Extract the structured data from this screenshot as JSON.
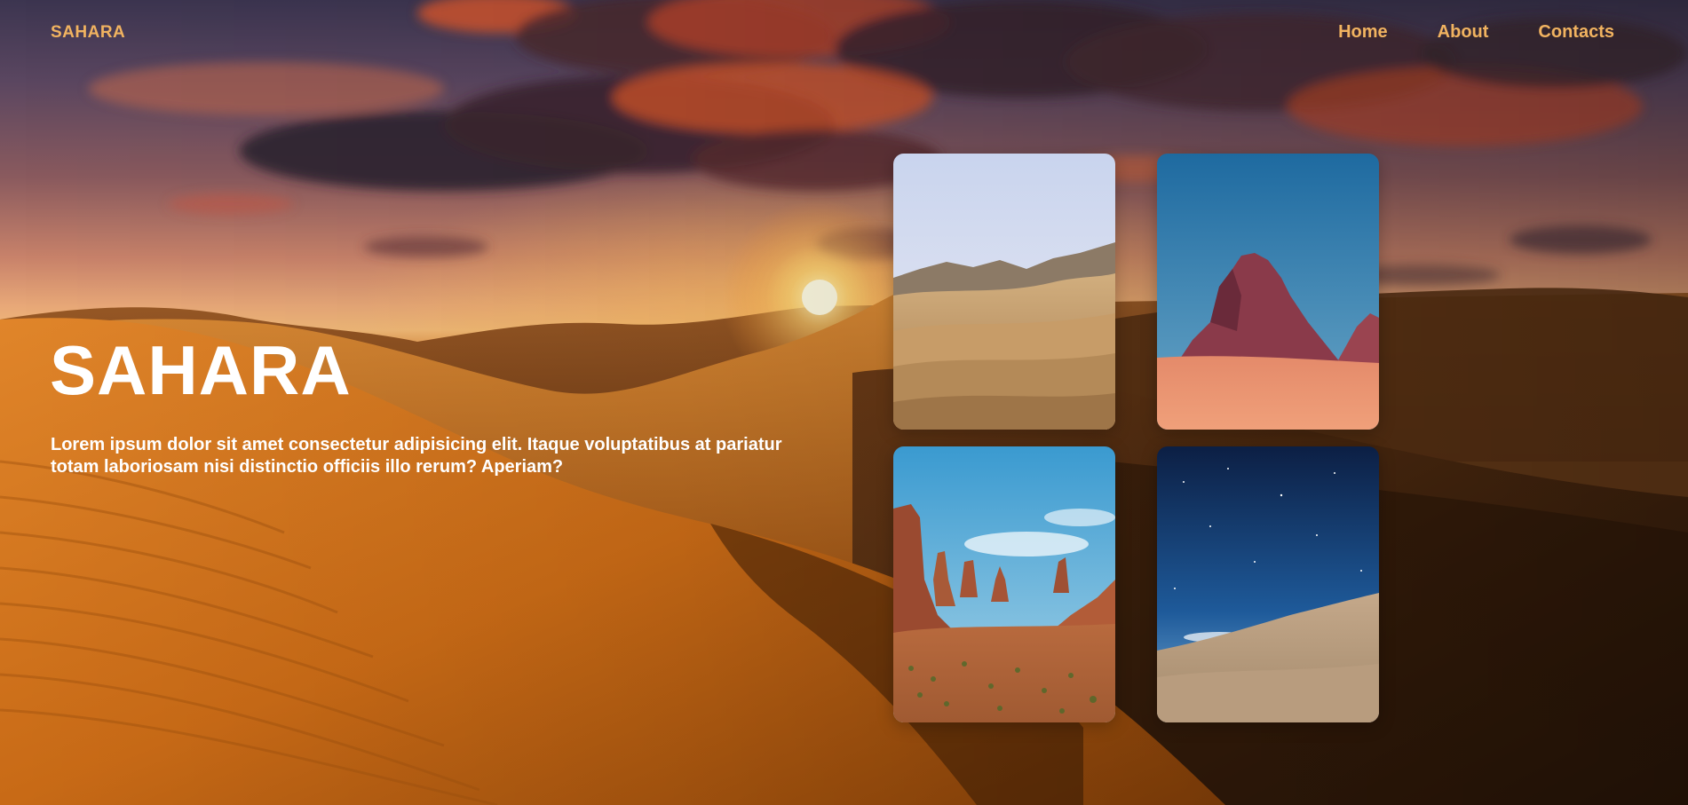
{
  "header": {
    "logo": "SAHARA",
    "nav": [
      "Home",
      "About",
      "Contacts"
    ]
  },
  "hero": {
    "title": "SAHARA",
    "text": "Lorem ipsum dolor sit amet consectetur adipisicing elit. Itaque voluptatibus at pariatur totam laboriosam nisi distinctio officiis illo rerum? Aperiam?"
  },
  "colors": {
    "accent": "#f1b360",
    "text": "#ffffff"
  },
  "gallery": [
    {
      "name": "desert-dunes-photo"
    },
    {
      "name": "red-rock-formation-photo"
    },
    {
      "name": "canyon-buttes-photo"
    },
    {
      "name": "night-sky-dunes-photo"
    }
  ]
}
